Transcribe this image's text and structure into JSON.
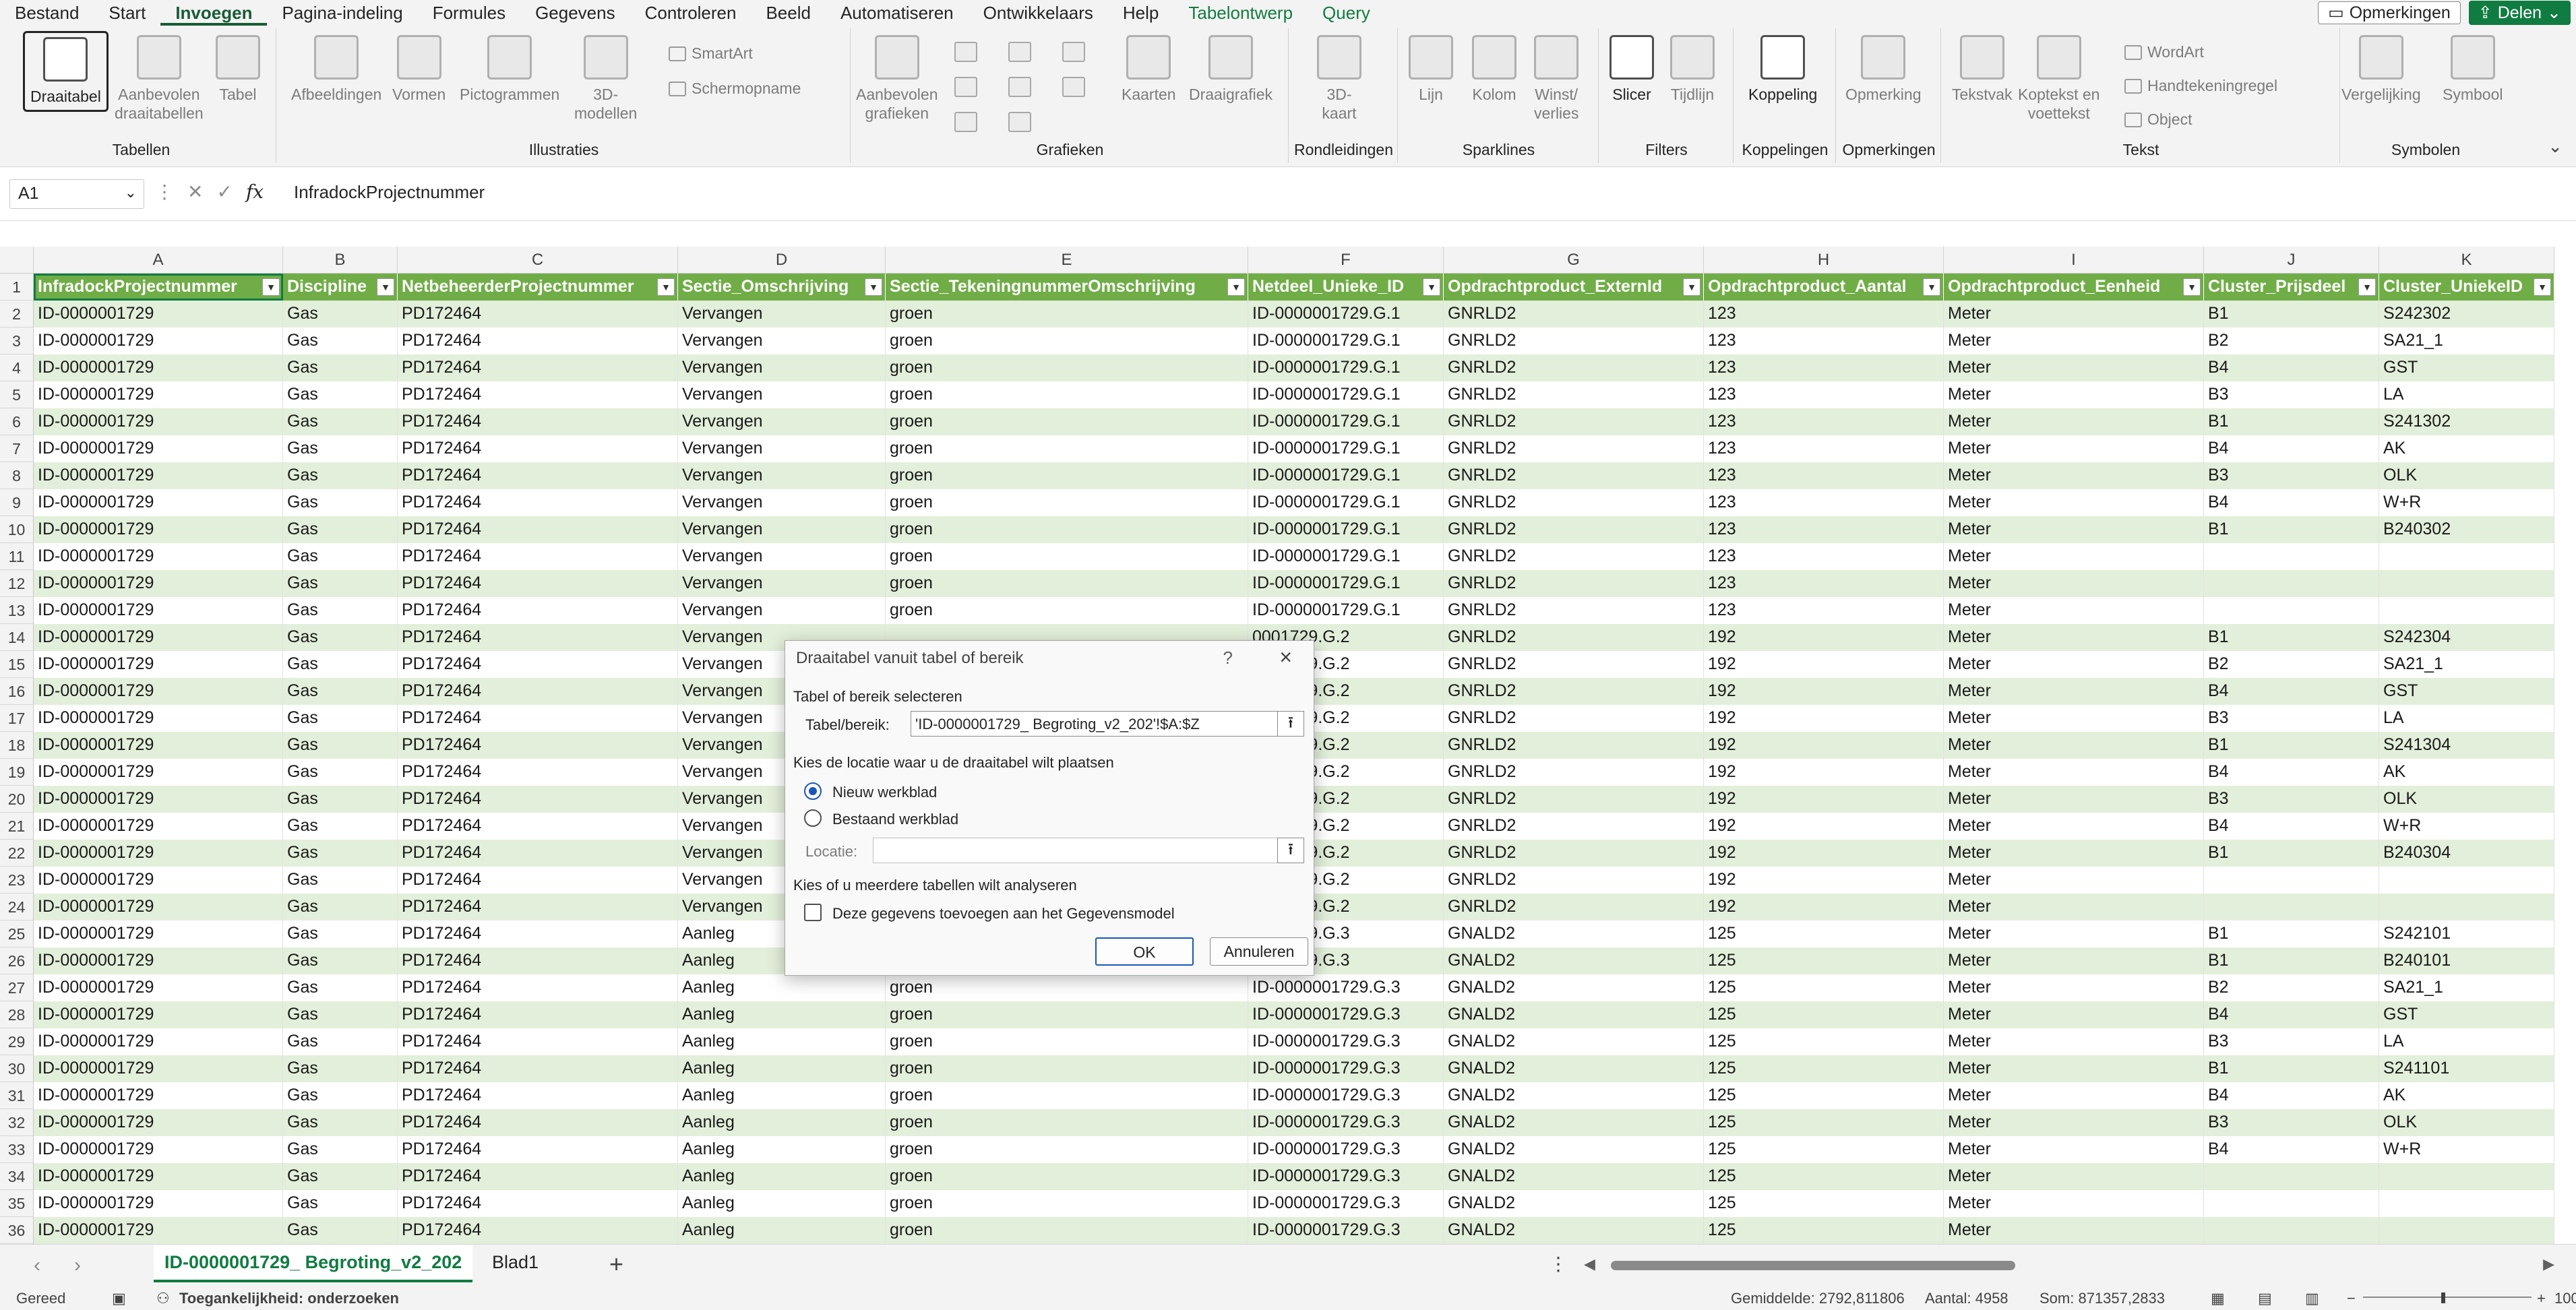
{
  "menu": {
    "tabs": [
      "Bestand",
      "Start",
      "Invoegen",
      "Pagina-indeling",
      "Formules",
      "Gegevens",
      "Controleren",
      "Beeld",
      "Automatiseren",
      "Ontwikkelaars",
      "Help",
      "Tabelontwerp",
      "Query"
    ],
    "active": "Invoegen",
    "comments_label": "Opmerkingen",
    "share_label": "Delen"
  },
  "ribbon": {
    "groups": {
      "tabellen": "Tabellen",
      "illustraties": "Illustraties",
      "grafieken": "Grafieken",
      "rondleidingen": "Rondleidingen",
      "sparklines": "Sparklines",
      "filters": "Filters",
      "koppelingen": "Koppelingen",
      "opmerkingen": "Opmerkingen",
      "tekst": "Tekst",
      "symbolen": "Symbolen"
    },
    "buttons": {
      "draaitabel": "Draaitabel",
      "aanbevolen_draaitabellen_1": "Aanbevolen",
      "aanbevolen_draaitabellen_2": "draaitabellen",
      "tabel": "Tabel",
      "afbeeldingen": "Afbeeldingen",
      "vormen": "Vormen",
      "pictogrammen": "Pictogrammen",
      "modellen_1": "3D-",
      "modellen_2": "modellen",
      "smartart": "SmartArt",
      "schermopname": "Schermopname",
      "aanbevolen_grafieken_1": "Aanbevolen",
      "aanbevolen_grafieken_2": "grafieken",
      "kaarten": "Kaarten",
      "draaigrafiek": "Draaigrafiek",
      "kaart_1": "3D-",
      "kaart_2": "kaart",
      "lijn": "Lijn",
      "kolom": "Kolom",
      "winst_1": "Winst/",
      "winst_2": "verlies",
      "slicer": "Slicer",
      "tijdlijn": "Tijdlijn",
      "koppeling": "Koppeling",
      "opmerking": "Opmerking",
      "tekstvak": "Tekstvak",
      "koptekst_1": "Koptekst en",
      "koptekst_2": "voettekst",
      "wordart": "WordArt",
      "handtekeningregel": "Handtekeningregel",
      "object": "Object",
      "vergelijking": "Vergelijking",
      "symbool": "Symbool"
    }
  },
  "formula": {
    "namebox": "A1",
    "content": "InfradockProjectnummer"
  },
  "grid": {
    "columns": [
      "A",
      "B",
      "C",
      "D",
      "E",
      "F",
      "G",
      "H",
      "I",
      "J",
      "K"
    ],
    "headers": [
      "InfradockProjectnummer",
      "Discipline",
      "NetbeheerderProjectnummer",
      "Sectie_Omschrijving",
      "Sectie_TekeningnummerOmschrijving",
      "Netdeel_Unieke_ID",
      "Opdrachtproduct_ExternId",
      "Opdrachtproduct_Aantal",
      "Opdrachtproduct_Eenheid",
      "Cluster_Prijsdeel",
      "Cluster_UniekeID"
    ],
    "rows": [
      [
        "ID-0000001729",
        "Gas",
        "PD172464",
        "Vervangen",
        "groen",
        "ID-0000001729.G.1",
        "GNRLD2",
        "123",
        "Meter",
        "B1",
        "S242302"
      ],
      [
        "ID-0000001729",
        "Gas",
        "PD172464",
        "Vervangen",
        "groen",
        "ID-0000001729.G.1",
        "GNRLD2",
        "123",
        "Meter",
        "B2",
        "SA21_1"
      ],
      [
        "ID-0000001729",
        "Gas",
        "PD172464",
        "Vervangen",
        "groen",
        "ID-0000001729.G.1",
        "GNRLD2",
        "123",
        "Meter",
        "B4",
        "GST"
      ],
      [
        "ID-0000001729",
        "Gas",
        "PD172464",
        "Vervangen",
        "groen",
        "ID-0000001729.G.1",
        "GNRLD2",
        "123",
        "Meter",
        "B3",
        "LA"
      ],
      [
        "ID-0000001729",
        "Gas",
        "PD172464",
        "Vervangen",
        "groen",
        "ID-0000001729.G.1",
        "GNRLD2",
        "123",
        "Meter",
        "B1",
        "S241302"
      ],
      [
        "ID-0000001729",
        "Gas",
        "PD172464",
        "Vervangen",
        "groen",
        "ID-0000001729.G.1",
        "GNRLD2",
        "123",
        "Meter",
        "B4",
        "AK"
      ],
      [
        "ID-0000001729",
        "Gas",
        "PD172464",
        "Vervangen",
        "groen",
        "ID-0000001729.G.1",
        "GNRLD2",
        "123",
        "Meter",
        "B3",
        "OLK"
      ],
      [
        "ID-0000001729",
        "Gas",
        "PD172464",
        "Vervangen",
        "groen",
        "ID-0000001729.G.1",
        "GNRLD2",
        "123",
        "Meter",
        "B4",
        "W+R"
      ],
      [
        "ID-0000001729",
        "Gas",
        "PD172464",
        "Vervangen",
        "groen",
        "ID-0000001729.G.1",
        "GNRLD2",
        "123",
        "Meter",
        "B1",
        "B240302"
      ],
      [
        "ID-0000001729",
        "Gas",
        "PD172464",
        "Vervangen",
        "groen",
        "ID-0000001729.G.1",
        "GNRLD2",
        "123",
        "Meter",
        "",
        ""
      ],
      [
        "ID-0000001729",
        "Gas",
        "PD172464",
        "Vervangen",
        "groen",
        "ID-0000001729.G.1",
        "GNRLD2",
        "123",
        "Meter",
        "",
        ""
      ],
      [
        "ID-0000001729",
        "Gas",
        "PD172464",
        "Vervangen",
        "groen",
        "ID-0000001729.G.1",
        "GNRLD2",
        "123",
        "Meter",
        "",
        ""
      ],
      [
        "ID-0000001729",
        "Gas",
        "PD172464",
        "Vervangen",
        "",
        "0001729.G.2",
        "GNRLD2",
        "192",
        "Meter",
        "B1",
        "S242304"
      ],
      [
        "ID-0000001729",
        "Gas",
        "PD172464",
        "Vervangen",
        "",
        "0001729.G.2",
        "GNRLD2",
        "192",
        "Meter",
        "B2",
        "SA21_1"
      ],
      [
        "ID-0000001729",
        "Gas",
        "PD172464",
        "Vervangen",
        "",
        "0001729.G.2",
        "GNRLD2",
        "192",
        "Meter",
        "B4",
        "GST"
      ],
      [
        "ID-0000001729",
        "Gas",
        "PD172464",
        "Vervangen",
        "",
        "0001729.G.2",
        "GNRLD2",
        "192",
        "Meter",
        "B3",
        "LA"
      ],
      [
        "ID-0000001729",
        "Gas",
        "PD172464",
        "Vervangen",
        "",
        "0001729.G.2",
        "GNRLD2",
        "192",
        "Meter",
        "B1",
        "S241304"
      ],
      [
        "ID-0000001729",
        "Gas",
        "PD172464",
        "Vervangen",
        "",
        "0001729.G.2",
        "GNRLD2",
        "192",
        "Meter",
        "B4",
        "AK"
      ],
      [
        "ID-0000001729",
        "Gas",
        "PD172464",
        "Vervangen",
        "",
        "0001729.G.2",
        "GNRLD2",
        "192",
        "Meter",
        "B3",
        "OLK"
      ],
      [
        "ID-0000001729",
        "Gas",
        "PD172464",
        "Vervangen",
        "",
        "0001729.G.2",
        "GNRLD2",
        "192",
        "Meter",
        "B4",
        "W+R"
      ],
      [
        "ID-0000001729",
        "Gas",
        "PD172464",
        "Vervangen",
        "",
        "0001729.G.2",
        "GNRLD2",
        "192",
        "Meter",
        "B1",
        "B240304"
      ],
      [
        "ID-0000001729",
        "Gas",
        "PD172464",
        "Vervangen",
        "",
        "0001729.G.2",
        "GNRLD2",
        "192",
        "Meter",
        "",
        ""
      ],
      [
        "ID-0000001729",
        "Gas",
        "PD172464",
        "Vervangen",
        "",
        "0001729.G.2",
        "GNRLD2",
        "192",
        "Meter",
        "",
        ""
      ],
      [
        "ID-0000001729",
        "Gas",
        "PD172464",
        "Aanleg",
        "",
        "0001729.G.3",
        "GNALD2",
        "125",
        "Meter",
        "B1",
        "S242101"
      ],
      [
        "ID-0000001729",
        "Gas",
        "PD172464",
        "Aanleg",
        "",
        "0001729.G.3",
        "GNALD2",
        "125",
        "Meter",
        "B1",
        "B240101"
      ],
      [
        "ID-0000001729",
        "Gas",
        "PD172464",
        "Aanleg",
        "groen",
        "ID-0000001729.G.3",
        "GNALD2",
        "125",
        "Meter",
        "B2",
        "SA21_1"
      ],
      [
        "ID-0000001729",
        "Gas",
        "PD172464",
        "Aanleg",
        "groen",
        "ID-0000001729.G.3",
        "GNALD2",
        "125",
        "Meter",
        "B4",
        "GST"
      ],
      [
        "ID-0000001729",
        "Gas",
        "PD172464",
        "Aanleg",
        "groen",
        "ID-0000001729.G.3",
        "GNALD2",
        "125",
        "Meter",
        "B3",
        "LA"
      ],
      [
        "ID-0000001729",
        "Gas",
        "PD172464",
        "Aanleg",
        "groen",
        "ID-0000001729.G.3",
        "GNALD2",
        "125",
        "Meter",
        "B1",
        "S241101"
      ],
      [
        "ID-0000001729",
        "Gas",
        "PD172464",
        "Aanleg",
        "groen",
        "ID-0000001729.G.3",
        "GNALD2",
        "125",
        "Meter",
        "B4",
        "AK"
      ],
      [
        "ID-0000001729",
        "Gas",
        "PD172464",
        "Aanleg",
        "groen",
        "ID-0000001729.G.3",
        "GNALD2",
        "125",
        "Meter",
        "B3",
        "OLK"
      ],
      [
        "ID-0000001729",
        "Gas",
        "PD172464",
        "Aanleg",
        "groen",
        "ID-0000001729.G.3",
        "GNALD2",
        "125",
        "Meter",
        "B4",
        "W+R"
      ],
      [
        "ID-0000001729",
        "Gas",
        "PD172464",
        "Aanleg",
        "groen",
        "ID-0000001729.G.3",
        "GNALD2",
        "125",
        "Meter",
        "",
        ""
      ],
      [
        "ID-0000001729",
        "Gas",
        "PD172464",
        "Aanleg",
        "groen",
        "ID-0000001729.G.3",
        "GNALD2",
        "125",
        "Meter",
        "",
        ""
      ],
      [
        "ID-0000001729",
        "Gas",
        "PD172464",
        "Aanleg",
        "groen",
        "ID-0000001729.G.3",
        "GNALD2",
        "125",
        "Meter",
        "",
        ""
      ]
    ]
  },
  "dialog": {
    "title": "Draaitabel vanuit tabel of bereik",
    "help": "?",
    "section_select": "Tabel of bereik selecteren",
    "range_label": "Tabel/bereik:",
    "range_value": "'ID-0000001729_ Begroting_v2_202'!$A:$Z",
    "section_location": "Kies de locatie waar u de draaitabel wilt plaatsen",
    "option_new": "Nieuw werkblad",
    "option_existing": "Bestaand werkblad",
    "location_label": "Locatie:",
    "location_value": "",
    "section_multi": "Kies of u meerdere tabellen wilt analyseren",
    "datamodel_label": "Deze gegevens toevoegen aan het Gegevensmodel",
    "ok": "OK",
    "cancel": "Annuleren"
  },
  "sheets": {
    "tabs": [
      "ID-0000001729_ Begroting_v2_202",
      "Blad1"
    ],
    "active": "ID-0000001729_ Begroting_v2_202"
  },
  "status": {
    "ready": "Gereed",
    "accessibility": "Toegankelijkheid: onderzoeken",
    "average": "Gemiddelde: 2792,811806",
    "count": "Aantal: 4958",
    "sum": "Som: 871357,2833",
    "zoom": "100%"
  }
}
